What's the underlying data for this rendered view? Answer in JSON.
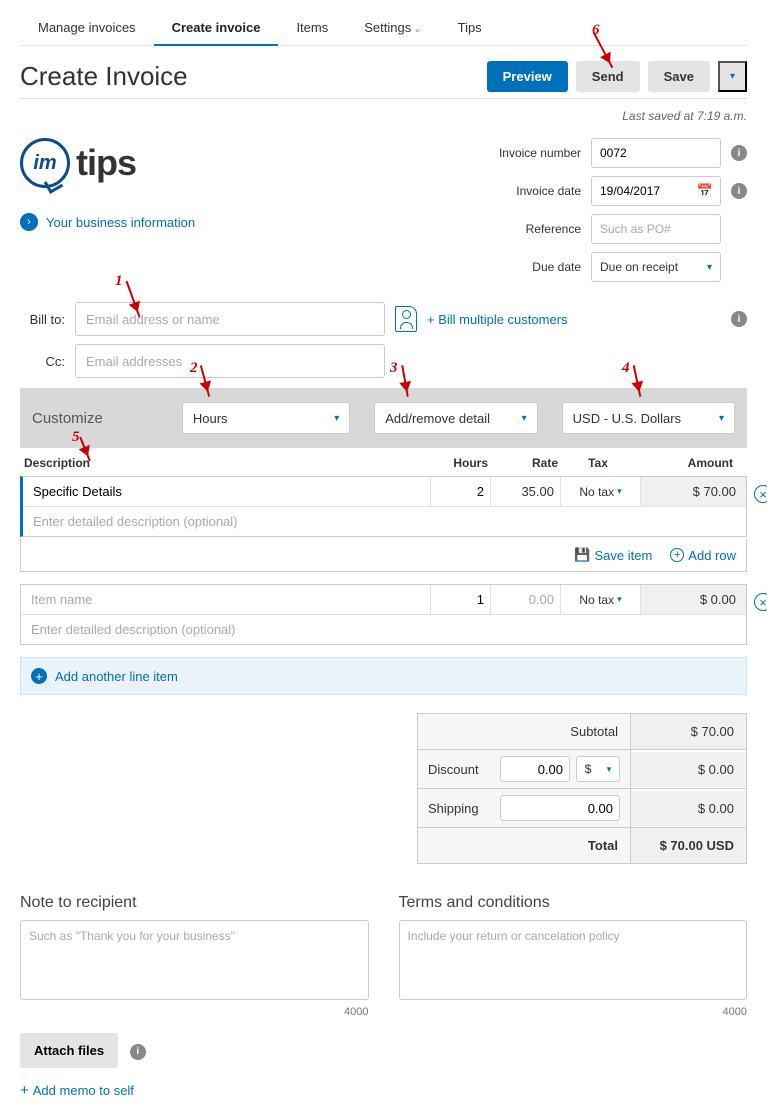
{
  "tabs": {
    "manage": "Manage invoices",
    "create": "Create invoice",
    "items": "Items",
    "settings": "Settings",
    "tips": "Tips"
  },
  "page_title": "Create Invoice",
  "buttons": {
    "preview": "Preview",
    "send": "Send",
    "save": "Save"
  },
  "last_saved": "Last saved at 7:19 a.m.",
  "logo": {
    "badge": "im",
    "text": "tips"
  },
  "biz_info_link": "Your business information",
  "meta": {
    "invoice_number_label": "Invoice number",
    "invoice_number": "0072",
    "invoice_date_label": "Invoice date",
    "invoice_date": "19/04/2017",
    "reference_label": "Reference",
    "reference_placeholder": "Such as PO#",
    "due_date_label": "Due date",
    "due_date": "Due on receipt"
  },
  "bill": {
    "to_label": "Bill to:",
    "to_placeholder": "Email address or name",
    "cc_label": "Cc:",
    "cc_placeholder": "Email addresses",
    "multiple_link": "+ Bill multiple customers"
  },
  "customize": {
    "label": "Customize",
    "sel1": "Hours",
    "sel2": "Add/remove detail",
    "sel3": "USD - U.S. Dollars"
  },
  "columns": {
    "desc": "Description",
    "hours": "Hours",
    "rate": "Rate",
    "tax": "Tax",
    "amount": "Amount"
  },
  "line1": {
    "name": "Specific Details",
    "hours": "2",
    "rate": "35.00",
    "tax": "No tax",
    "amount": "$ 70.00",
    "desc_placeholder": "Enter detailed description (optional)"
  },
  "item_actions": {
    "save": "Save item",
    "add": "Add row"
  },
  "line2": {
    "name_placeholder": "Item name",
    "hours": "1",
    "rate": "0.00",
    "tax": "No tax",
    "amount": "$ 0.00",
    "desc_placeholder": "Enter detailed description (optional)"
  },
  "add_line": "Add another line item",
  "totals": {
    "subtotal_label": "Subtotal",
    "subtotal": "$ 70.00",
    "discount_label": "Discount",
    "discount_val": "0.00",
    "discount_unit": "$",
    "discount_amt": "$ 0.00",
    "shipping_label": "Shipping",
    "shipping_val": "0.00",
    "shipping_amt": "$ 0.00",
    "total_label": "Total",
    "total": "$ 70.00 USD"
  },
  "notes": {
    "recipient_title": "Note to recipient",
    "recipient_placeholder": "Such as \"Thank you for your business\"",
    "recipient_count": "4000",
    "terms_title": "Terms and conditions",
    "terms_placeholder": "Include your return or cancelation policy",
    "terms_count": "4000"
  },
  "attach": "Attach files",
  "memo": "Add memo to self",
  "annotations": {
    "n1": "1",
    "n2": "2",
    "n3": "3",
    "n4": "4",
    "n5": "5",
    "n6": "6"
  }
}
